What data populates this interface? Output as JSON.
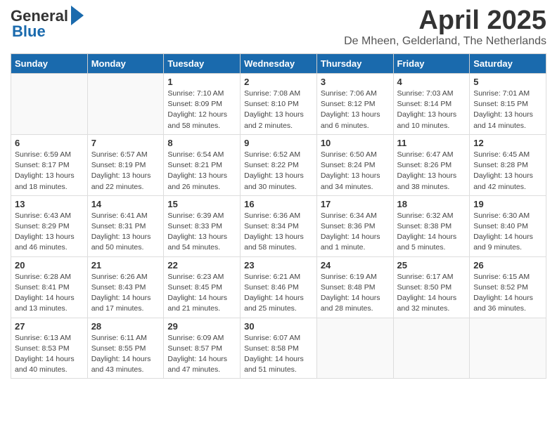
{
  "header": {
    "logo_general": "General",
    "logo_blue": "Blue",
    "month_title": "April 2025",
    "location": "De Mheen, Gelderland, The Netherlands"
  },
  "days_of_week": [
    "Sunday",
    "Monday",
    "Tuesday",
    "Wednesday",
    "Thursday",
    "Friday",
    "Saturday"
  ],
  "weeks": [
    [
      {
        "day": "",
        "info": ""
      },
      {
        "day": "",
        "info": ""
      },
      {
        "day": "1",
        "info": "Sunrise: 7:10 AM\nSunset: 8:09 PM\nDaylight: 12 hours\nand 58 minutes."
      },
      {
        "day": "2",
        "info": "Sunrise: 7:08 AM\nSunset: 8:10 PM\nDaylight: 13 hours\nand 2 minutes."
      },
      {
        "day": "3",
        "info": "Sunrise: 7:06 AM\nSunset: 8:12 PM\nDaylight: 13 hours\nand 6 minutes."
      },
      {
        "day": "4",
        "info": "Sunrise: 7:03 AM\nSunset: 8:14 PM\nDaylight: 13 hours\nand 10 minutes."
      },
      {
        "day": "5",
        "info": "Sunrise: 7:01 AM\nSunset: 8:15 PM\nDaylight: 13 hours\nand 14 minutes."
      }
    ],
    [
      {
        "day": "6",
        "info": "Sunrise: 6:59 AM\nSunset: 8:17 PM\nDaylight: 13 hours\nand 18 minutes."
      },
      {
        "day": "7",
        "info": "Sunrise: 6:57 AM\nSunset: 8:19 PM\nDaylight: 13 hours\nand 22 minutes."
      },
      {
        "day": "8",
        "info": "Sunrise: 6:54 AM\nSunset: 8:21 PM\nDaylight: 13 hours\nand 26 minutes."
      },
      {
        "day": "9",
        "info": "Sunrise: 6:52 AM\nSunset: 8:22 PM\nDaylight: 13 hours\nand 30 minutes."
      },
      {
        "day": "10",
        "info": "Sunrise: 6:50 AM\nSunset: 8:24 PM\nDaylight: 13 hours\nand 34 minutes."
      },
      {
        "day": "11",
        "info": "Sunrise: 6:47 AM\nSunset: 8:26 PM\nDaylight: 13 hours\nand 38 minutes."
      },
      {
        "day": "12",
        "info": "Sunrise: 6:45 AM\nSunset: 8:28 PM\nDaylight: 13 hours\nand 42 minutes."
      }
    ],
    [
      {
        "day": "13",
        "info": "Sunrise: 6:43 AM\nSunset: 8:29 PM\nDaylight: 13 hours\nand 46 minutes."
      },
      {
        "day": "14",
        "info": "Sunrise: 6:41 AM\nSunset: 8:31 PM\nDaylight: 13 hours\nand 50 minutes."
      },
      {
        "day": "15",
        "info": "Sunrise: 6:39 AM\nSunset: 8:33 PM\nDaylight: 13 hours\nand 54 minutes."
      },
      {
        "day": "16",
        "info": "Sunrise: 6:36 AM\nSunset: 8:34 PM\nDaylight: 13 hours\nand 58 minutes."
      },
      {
        "day": "17",
        "info": "Sunrise: 6:34 AM\nSunset: 8:36 PM\nDaylight: 14 hours\nand 1 minute."
      },
      {
        "day": "18",
        "info": "Sunrise: 6:32 AM\nSunset: 8:38 PM\nDaylight: 14 hours\nand 5 minutes."
      },
      {
        "day": "19",
        "info": "Sunrise: 6:30 AM\nSunset: 8:40 PM\nDaylight: 14 hours\nand 9 minutes."
      }
    ],
    [
      {
        "day": "20",
        "info": "Sunrise: 6:28 AM\nSunset: 8:41 PM\nDaylight: 14 hours\nand 13 minutes."
      },
      {
        "day": "21",
        "info": "Sunrise: 6:26 AM\nSunset: 8:43 PM\nDaylight: 14 hours\nand 17 minutes."
      },
      {
        "day": "22",
        "info": "Sunrise: 6:23 AM\nSunset: 8:45 PM\nDaylight: 14 hours\nand 21 minutes."
      },
      {
        "day": "23",
        "info": "Sunrise: 6:21 AM\nSunset: 8:46 PM\nDaylight: 14 hours\nand 25 minutes."
      },
      {
        "day": "24",
        "info": "Sunrise: 6:19 AM\nSunset: 8:48 PM\nDaylight: 14 hours\nand 28 minutes."
      },
      {
        "day": "25",
        "info": "Sunrise: 6:17 AM\nSunset: 8:50 PM\nDaylight: 14 hours\nand 32 minutes."
      },
      {
        "day": "26",
        "info": "Sunrise: 6:15 AM\nSunset: 8:52 PM\nDaylight: 14 hours\nand 36 minutes."
      }
    ],
    [
      {
        "day": "27",
        "info": "Sunrise: 6:13 AM\nSunset: 8:53 PM\nDaylight: 14 hours\nand 40 minutes."
      },
      {
        "day": "28",
        "info": "Sunrise: 6:11 AM\nSunset: 8:55 PM\nDaylight: 14 hours\nand 43 minutes."
      },
      {
        "day": "29",
        "info": "Sunrise: 6:09 AM\nSunset: 8:57 PM\nDaylight: 14 hours\nand 47 minutes."
      },
      {
        "day": "30",
        "info": "Sunrise: 6:07 AM\nSunset: 8:58 PM\nDaylight: 14 hours\nand 51 minutes."
      },
      {
        "day": "",
        "info": ""
      },
      {
        "day": "",
        "info": ""
      },
      {
        "day": "",
        "info": ""
      }
    ]
  ]
}
